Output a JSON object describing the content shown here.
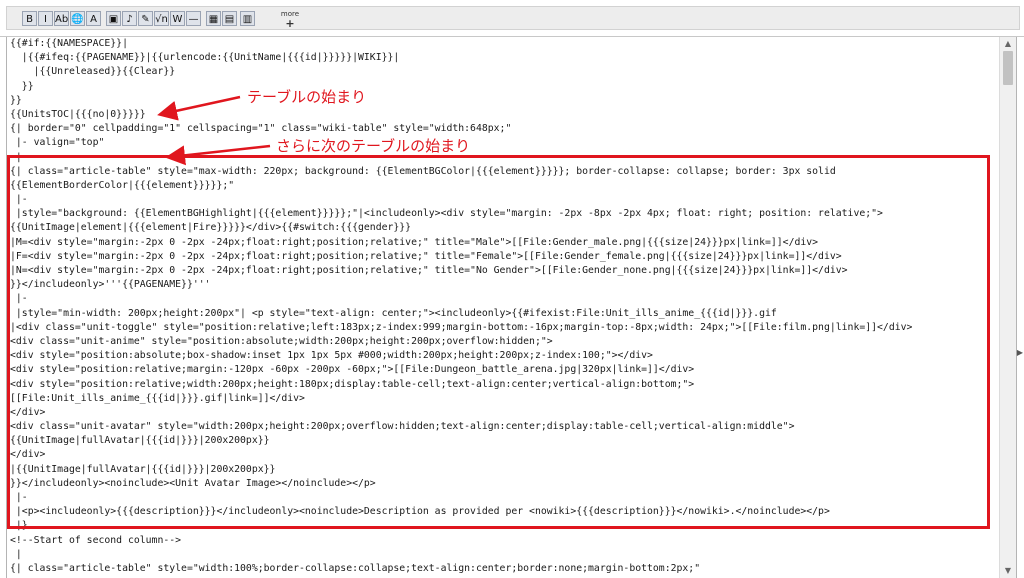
{
  "toolbar": {
    "buttons": [
      {
        "name": "bold-button",
        "glyph": "B"
      },
      {
        "name": "italic-button",
        "glyph": "I"
      },
      {
        "name": "internal-link-button",
        "glyph": "Ab"
      },
      {
        "name": "external-link-button",
        "glyph": "🌐"
      },
      {
        "name": "headline-button",
        "glyph": "A"
      },
      {
        "name": "image-button",
        "glyph": "▣"
      },
      {
        "name": "media-button",
        "glyph": "♪"
      },
      {
        "name": "signature-button",
        "glyph": "✎"
      },
      {
        "name": "math-button",
        "glyph": "√n"
      },
      {
        "name": "nowiki-button",
        "glyph": "W"
      },
      {
        "name": "hr-button",
        "glyph": "—"
      },
      {
        "name": "table-button",
        "glyph": "▦"
      },
      {
        "name": "gallery-button",
        "glyph": "▤"
      },
      {
        "name": "redirect-button",
        "glyph": "▥"
      }
    ],
    "more_label": "more",
    "more_plus": "+"
  },
  "editor": {
    "lines": [
      "{{#if:{{NAMESPACE}}|",
      "  |{{#ifeq:{{PAGENAME}}|{{urlencode:{{UnitName|{{{id|}}}}}|WIKI}}|",
      "    |{{Unreleased}}{{Clear}}",
      "  }}",
      "}}",
      "{{UnitsTOC|{{{no|0}}}}}",
      "{| border=\"0\" cellpadding=\"1\" cellspacing=\"1\" class=\"wiki-table\" style=\"width:648px;\"",
      " |- valign=\"top\"",
      " |",
      "{| class=\"article-table\" style=\"max-width: 220px; background: {{ElementBGColor|{{{element}}}}}; border-collapse: collapse; border: 3px solid",
      "{{ElementBorderColor|{{{element}}}}};\"",
      " |-",
      " |style=\"background: {{ElementBGHighlight|{{{element}}}}};\"|<includeonly><div style=\"margin: -2px -8px -2px 4px; float: right; position: relative;\">",
      "{{UnitImage|element|{{{element|Fire}}}}}</div>{{#switch:{{{gender}}}",
      "|M=<div style=\"margin:-2px 0 -2px -24px;float:right;position;relative;\" title=\"Male\">[[File:Gender_male.png|{{{size|24}}}px|link=]]</div>",
      "|F=<div style=\"margin:-2px 0 -2px -24px;float:right;position;relative;\" title=\"Female\">[[File:Gender_female.png|{{{size|24}}}px|link=]]</div>",
      "|N=<div style=\"margin:-2px 0 -2px -24px;float:right;position;relative;\" title=\"No Gender\">[[File:Gender_none.png|{{{size|24}}}px|link=]]</div>",
      "}}</includeonly>'''{{PAGENAME}}'''",
      " |-",
      " |style=\"min-width: 200px;height:200px\"| <p style=\"text-align: center;\"><includeonly>{{#ifexist:File:Unit_ills_anime_{{{id|}}}.gif",
      "|<div class=\"unit-toggle\" style=\"position:relative;left:183px;z-index:999;margin-bottom:-16px;margin-top:-8px;width: 24px;\">[[File:film.png|link=]]</div>",
      "<div class=\"unit-anime\" style=\"position:absolute;width:200px;height:200px;overflow:hidden;\">",
      "<div style=\"position:absolute;box-shadow:inset 1px 1px 5px #000;width:200px;height:200px;z-index:100;\"></div>",
      "<div style=\"position:relative;margin:-120px -60px -200px -60px;\">[[File:Dungeon_battle_arena.jpg|320px|link=]]</div>",
      "<div style=\"position:relative;width:200px;height:180px;display:table-cell;text-align:center;vertical-align:bottom;\">",
      "[[File:Unit_ills_anime_{{{id|}}}.gif|link=]]</div>",
      "</div>",
      "<div class=\"unit-avatar\" style=\"width:200px;height:200px;overflow:hidden;text-align:center;display:table-cell;vertical-align:middle\">",
      "{{UnitImage|fullAvatar|{{{id|}}}|200x200px}}",
      "</div>",
      "|{{UnitImage|fullAvatar|{{{id|}}}|200x200px}}",
      "}}</includeonly><noinclude><Unit Avatar Image></noinclude></p>",
      " |-",
      " |<p><includeonly>{{{description}}}</includeonly><noinclude>Description as provided per <nowiki>{{{description}}}</nowiki>.</noinclude></p>",
      " |}",
      "<!--Start of second column-->",
      " |",
      "{| class=\"article-table\" style=\"width:100%;border-collapse:collapse;text-align:center;border:none;margin-bottom:2px;\""
    ]
  },
  "annotations": {
    "first": "テーブルの始まり",
    "second": "さらに次のテーブルの始まり",
    "color": "#e0161e"
  }
}
